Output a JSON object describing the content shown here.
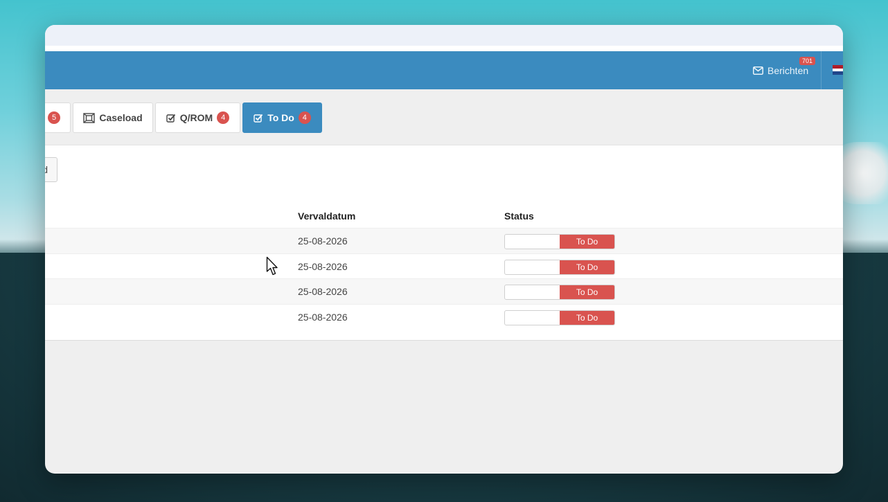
{
  "navbar": {
    "messages_label": "Berichten",
    "messages_count": "701",
    "flag_colors": [
      "#ae1c28",
      "#ffffff",
      "#21468b"
    ]
  },
  "tabs": [
    {
      "id": "partial",
      "label": "",
      "badge": "5",
      "icon": "none",
      "active": false
    },
    {
      "id": "caseload",
      "label": "Caseload",
      "badge": "",
      "icon": "caseload-icon",
      "active": false
    },
    {
      "id": "qrom",
      "label": "Q/ROM",
      "badge": "4",
      "icon": "check-square-icon",
      "active": false
    },
    {
      "id": "todo",
      "label": "To Do",
      "badge": "4",
      "icon": "check-square-icon",
      "active": true
    }
  ],
  "toolbar": {
    "partial_button_label": "d"
  },
  "table": {
    "columns": {
      "due_date": "Vervaldatum",
      "status": "Status"
    },
    "rows": [
      {
        "due_date": "25-08-2026",
        "status": "To Do"
      },
      {
        "due_date": "25-08-2026",
        "status": "To Do"
      },
      {
        "due_date": "25-08-2026",
        "status": "To Do"
      },
      {
        "due_date": "25-08-2026",
        "status": "To Do"
      }
    ]
  },
  "colors": {
    "primary": "#3b8bbf",
    "danger": "#d9534f",
    "page_bg": "#efefef"
  }
}
